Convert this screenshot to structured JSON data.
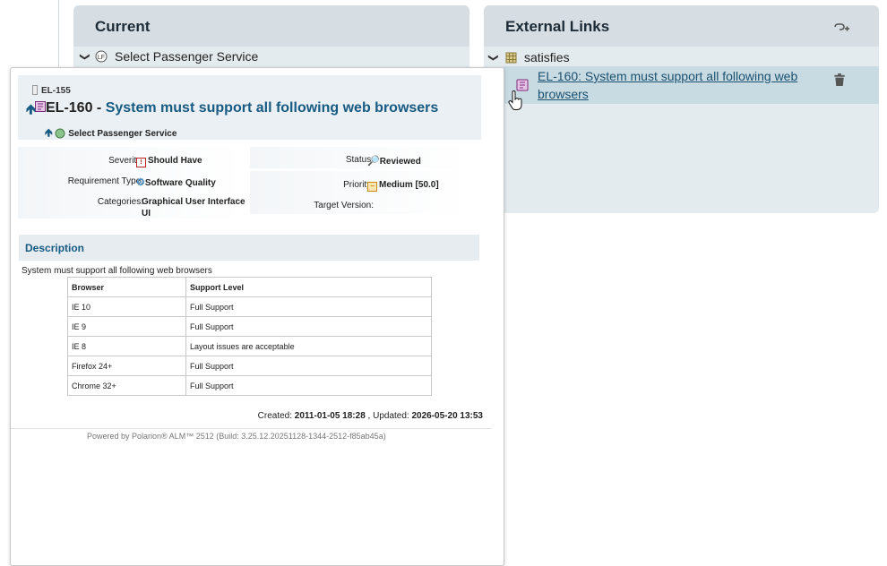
{
  "current_panel": {
    "title": "Current",
    "tree_item": "Select Passenger Service"
  },
  "external_links_panel": {
    "title": "External Links",
    "role": "satisfies",
    "link_text": "EL-160: System must support all following web browsers"
  },
  "popup": {
    "parent_id": "EL-155",
    "work_item_id": "EL-160",
    "title_separator": " - ",
    "work_item_title": "System must support all following web browsers",
    "linked_item": "Select Passenger Service",
    "fields": {
      "severity_label": "Severity:",
      "severity_value": "Should Have",
      "requirement_type_label": "Requirement Type:",
      "requirement_type_value": "Software Quality",
      "categories_label": "Categories:",
      "categories_value_line1": "Graphical User Interface",
      "categories_value_line2": "UI",
      "status_label": "Status:",
      "status_value": "Reviewed",
      "priority_label": "Priority:",
      "priority_value": "Medium [50.0]",
      "target_version_label": "Target Version:"
    },
    "description_heading": "Description",
    "description_text": "System must support all following web browsers",
    "table": {
      "headers": [
        "Browser",
        "Support Level"
      ],
      "rows": [
        [
          "IE 10",
          "Full Support"
        ],
        [
          "IE 9",
          "Full Support"
        ],
        [
          "IE 8",
          "Layout issues are acceptable"
        ],
        [
          "Firefox 24+",
          "Full Support"
        ],
        [
          "Chrome 32+",
          "Full Support"
        ]
      ]
    },
    "created_label": "Created:",
    "created_value": "2011-01-05 18:28",
    "updated_label": ", Updated:",
    "updated_value": "2026-05-20 13:53",
    "powered_by": "Powered by Polarion® ALM™ 2512 (Build: 3.25.12.20251128-1344-2512-f85ab45a)"
  }
}
